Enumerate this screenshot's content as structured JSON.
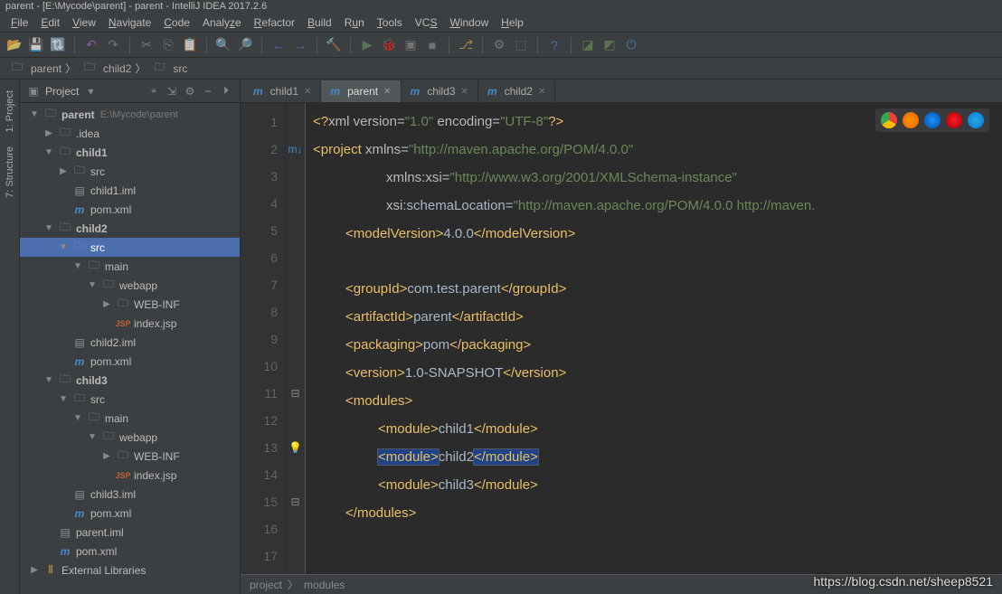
{
  "title": "parent - [E:\\Mycode\\parent] - parent - IntelliJ IDEA 2017.2.6",
  "menu": [
    "File",
    "Edit",
    "View",
    "Navigate",
    "Code",
    "Analyze",
    "Refactor",
    "Build",
    "Run",
    "Tools",
    "VCS",
    "Window",
    "Help"
  ],
  "breadcrumb": [
    {
      "icon": "folder",
      "label": "parent"
    },
    {
      "icon": "folder",
      "label": "child2"
    },
    {
      "icon": "folder",
      "label": "src"
    }
  ],
  "projectPanel": {
    "title": "Project"
  },
  "tree": [
    {
      "d": 0,
      "exp": "▼",
      "icon": "folder",
      "label": "parent",
      "sub": "E:\\Mycode\\parent",
      "bold": true
    },
    {
      "d": 1,
      "exp": "▶",
      "icon": "folder",
      "label": ".idea"
    },
    {
      "d": 1,
      "exp": "▼",
      "icon": "folder",
      "label": "child1",
      "bold": true
    },
    {
      "d": 2,
      "exp": "▶",
      "icon": "folder",
      "label": "src"
    },
    {
      "d": 2,
      "exp": "",
      "icon": "file",
      "label": "child1.iml"
    },
    {
      "d": 2,
      "exp": "",
      "icon": "mvn",
      "label": "pom.xml"
    },
    {
      "d": 1,
      "exp": "▼",
      "icon": "folder",
      "label": "child2",
      "bold": true
    },
    {
      "d": 2,
      "exp": "▼",
      "icon": "folder",
      "label": "src",
      "sel": true
    },
    {
      "d": 3,
      "exp": "▼",
      "icon": "folder",
      "label": "main"
    },
    {
      "d": 4,
      "exp": "▼",
      "icon": "folder",
      "label": "webapp"
    },
    {
      "d": 5,
      "exp": "▶",
      "icon": "folder",
      "label": "WEB-INF"
    },
    {
      "d": 5,
      "exp": "",
      "icon": "jsp",
      "label": "index.jsp"
    },
    {
      "d": 2,
      "exp": "",
      "icon": "file",
      "label": "child2.iml"
    },
    {
      "d": 2,
      "exp": "",
      "icon": "mvn",
      "label": "pom.xml"
    },
    {
      "d": 1,
      "exp": "▼",
      "icon": "folder",
      "label": "child3",
      "bold": true
    },
    {
      "d": 2,
      "exp": "▼",
      "icon": "folder",
      "label": "src"
    },
    {
      "d": 3,
      "exp": "▼",
      "icon": "folder",
      "label": "main"
    },
    {
      "d": 4,
      "exp": "▼",
      "icon": "folder",
      "label": "webapp"
    },
    {
      "d": 5,
      "exp": "▶",
      "icon": "folder",
      "label": "WEB-INF"
    },
    {
      "d": 5,
      "exp": "",
      "icon": "jsp",
      "label": "index.jsp"
    },
    {
      "d": 2,
      "exp": "",
      "icon": "file",
      "label": "child3.iml"
    },
    {
      "d": 2,
      "exp": "",
      "icon": "mvn",
      "label": "pom.xml"
    },
    {
      "d": 1,
      "exp": "",
      "icon": "file",
      "label": "parent.iml"
    },
    {
      "d": 1,
      "exp": "",
      "icon": "mvn",
      "label": "pom.xml"
    },
    {
      "d": 0,
      "exp": "▶",
      "icon": "lib",
      "label": "External Libraries"
    }
  ],
  "tabs": [
    {
      "label": "child1",
      "active": false
    },
    {
      "label": "parent",
      "active": true
    },
    {
      "label": "child3",
      "active": false
    },
    {
      "label": "child2",
      "active": false
    }
  ],
  "lineCount": 17,
  "code": {
    "l1_a": "<?",
    "l1_b": "xml version=",
    "l1_c": "\"1.0\"",
    "l1_d": " encoding=",
    "l1_e": "\"UTF-8\"",
    "l1_f": "?>",
    "l2_a": "<project ",
    "l2_b": "xmlns=",
    "l2_c": "\"http://maven.apache.org/POM/4.0.0\"",
    "l3_a": "xmlns:xsi=",
    "l3_b": "\"http://www.w3.org/2001/XMLSchema-instance\"",
    "l4_a": "xsi",
    "l4_b": ":schemaLocation=",
    "l4_c": "\"http://maven.apache.org/POM/4.0.0 http://maven.",
    "l5_a": "<modelVersion>",
    "l5_b": "4.0.0",
    "l5_c": "</modelVersion>",
    "l7_a": "<groupId>",
    "l7_b": "com.test.parent",
    "l7_c": "</groupId>",
    "l8_a": "<artifactId>",
    "l8_b": "parent",
    "l8_c": "</artifactId>",
    "l9_a": "<packaging>",
    "l9_b": "pom",
    "l9_c": "</packaging>",
    "l10_a": "<version>",
    "l10_b": "1.0-SNAPSHOT",
    "l10_c": "</version>",
    "l11": "<modules>",
    "l12_a": "<module>",
    "l12_b": "child1",
    "l12_c": "</module>",
    "l13_a": "<module>",
    "l13_b": "child2",
    "l13_c": "</module>",
    "l14_a": "<module>",
    "l14_b": "child3",
    "l14_c": "</module>",
    "l15": "</modules>"
  },
  "crumbs": [
    "project",
    "modules"
  ],
  "sideTabs": [
    "1: Project",
    "7: Structure"
  ],
  "watermark": "https://blog.csdn.net/sheep8521"
}
